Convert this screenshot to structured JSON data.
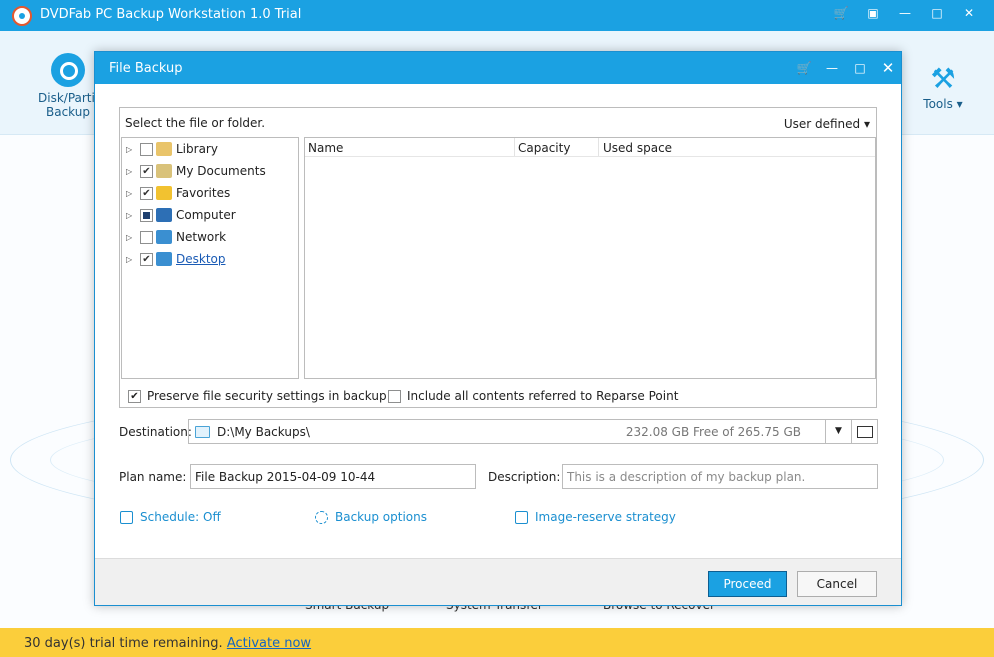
{
  "app": {
    "title": "DVDFab PC Backup Workstation 1.0 Trial",
    "toolbar_left": "Disk/Partit\nBackup",
    "toolbar_right": "Tools"
  },
  "bottom_tools": [
    "Smart Backup",
    "System Transfer",
    "Browse to Recover"
  ],
  "trial": {
    "text": "30 day(s) trial time remaining.",
    "link": "Activate now"
  },
  "dialog": {
    "title": "File Backup",
    "select_label": "Select the file or folder.",
    "mode": "User defined",
    "tree": [
      {
        "label": "Library",
        "state": "unchecked",
        "icon_color": "#e9c46a"
      },
      {
        "label": "My Documents",
        "state": "checked",
        "icon_color": "#d9c27a"
      },
      {
        "label": "Favorites",
        "state": "checked",
        "icon_color": "#f2c230"
      },
      {
        "label": "Computer",
        "state": "partial",
        "icon_color": "#2d6fb5"
      },
      {
        "label": "Network",
        "state": "unchecked",
        "icon_color": "#3a8fd1"
      },
      {
        "label": "Desktop",
        "state": "checked",
        "icon_color": "#3a8fd1"
      }
    ],
    "columns": [
      "Name",
      "Capacity",
      "Used space"
    ],
    "preserve_label": "Preserve file security settings in backup",
    "preserve_checked": true,
    "reparse_label": "Include all contents referred to Reparse Point",
    "reparse_checked": false,
    "destination_label": "Destination:",
    "destination_path": "D:\\My Backups\\",
    "destination_free": "232.08 GB Free of 265.75 GB",
    "plan_label": "Plan name:",
    "plan_value": "File Backup 2015-04-09 10-44",
    "description_label": "Description:",
    "description_placeholder": "This is a description of my backup plan.",
    "schedule_label": "Schedule: Off",
    "backup_options_label": "Backup options",
    "image_reserve_label": "Image-reserve strategy",
    "proceed_label": "Proceed",
    "cancel_label": "Cancel"
  }
}
